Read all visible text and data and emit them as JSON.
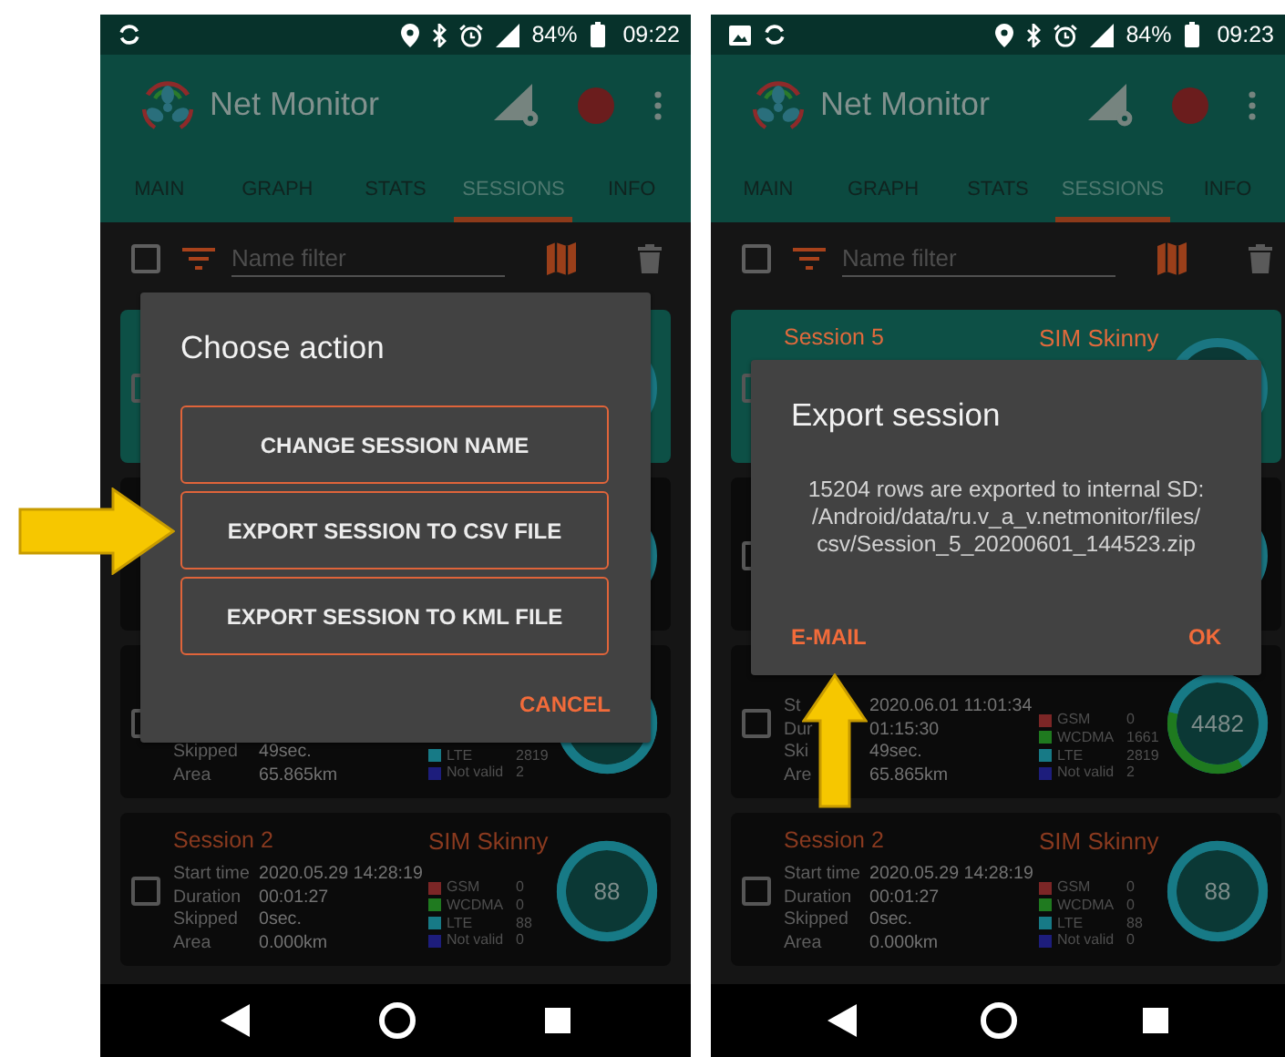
{
  "phones": [
    {
      "status_bar": {
        "notification_icons": [
          {
            "kind": "sync"
          }
        ],
        "battery": "84%",
        "time": "09:22"
      },
      "app_bar": {
        "title": "Net Monitor"
      },
      "tabs": [
        {
          "label": "MAIN",
          "selected": false
        },
        {
          "label": "GRAPH",
          "selected": false
        },
        {
          "label": "STATS",
          "selected": false
        },
        {
          "label": "SESSIONS",
          "selected": true
        },
        {
          "label": "INFO",
          "selected": false
        }
      ],
      "toolbar": {
        "select_all": {
          "checked": false
        },
        "placeholder": "Name filter"
      },
      "sessions": [
        {
          "selected": true,
          "checked": false
        },
        {
          "selected": false
        },
        {
          "selected": false,
          "checked": false,
          "stats": [
            {
              "label": "Skipped",
              "value": "49sec."
            },
            {
              "label": "Area",
              "value": "65.865km"
            }
          ],
          "legend": [
            {
              "name": "LTE",
              "value": "2819",
              "color": "#177a86"
            },
            {
              "name": "Not valid",
              "value": "2",
              "color": "#1d1d7c"
            }
          ]
        },
        {
          "selected": false,
          "checked": false,
          "name": "Session 2",
          "sim": "SIM Skinny",
          "stats": [
            {
              "label": "Start time",
              "value": "2020.05.29 14:28:19"
            },
            {
              "label": "Duration",
              "value": "00:01:27"
            },
            {
              "label": "Skipped",
              "value": "0sec."
            },
            {
              "label": "Area",
              "value": "0.000km"
            }
          ],
          "legend": [
            {
              "name": "GSM",
              "value": "0",
              "color": "#7c2626"
            },
            {
              "name": "WCDMA",
              "value": "0",
              "color": "#1f7a1f"
            },
            {
              "name": "LTE",
              "value": "88",
              "color": "#177a86"
            },
            {
              "name": "Not valid",
              "value": "0",
              "color": "#1d1d7c"
            }
          ],
          "count": "88"
        }
      ],
      "dialog": {
        "title": "Choose action",
        "options": [
          {
            "label": "CHANGE SESSION NAME",
            "highlighted": false
          },
          {
            "label": "EXPORT SESSION TO CSV FILE",
            "highlighted": true
          },
          {
            "label": "EXPORT SESSION TO KML FILE",
            "highlighted": false
          }
        ],
        "actions": [
          {
            "label": "CANCEL",
            "kind": "negative",
            "highlighted": false
          }
        ]
      }
    },
    {
      "status_bar": {
        "notification_icons": [
          {
            "kind": "image"
          },
          {
            "kind": "sync"
          }
        ],
        "battery": "84%",
        "time": "09:23"
      },
      "app_bar": {
        "title": "Net Monitor"
      },
      "tabs": [
        {
          "label": "MAIN",
          "selected": false
        },
        {
          "label": "GRAPH",
          "selected": false
        },
        {
          "label": "STATS",
          "selected": false
        },
        {
          "label": "SESSIONS",
          "selected": true
        },
        {
          "label": "INFO",
          "selected": false
        }
      ],
      "toolbar": {
        "select_all": {
          "checked": false
        },
        "placeholder": "Name filter"
      },
      "sessions": [
        {
          "selected": true,
          "checked": false,
          "name": "Session 5",
          "sim": "SIM Skinny"
        },
        {
          "selected": false,
          "checked": false
        },
        {
          "selected": false,
          "checked": false,
          "stats": [
            {
              "label": "St",
              "value": "2020.06.01 11:01:34"
            },
            {
              "label": "Dur",
              "value": "01:15:30"
            },
            {
              "label": "Ski",
              "value": "49sec."
            },
            {
              "label": "Are",
              "value": "65.865km"
            }
          ],
          "legend": [
            {
              "name": "GSM",
              "value": "0",
              "color": "#7c2626"
            },
            {
              "name": "WCDMA",
              "value": "1661",
              "color": "#1f7a1f"
            },
            {
              "name": "LTE",
              "value": "2819",
              "color": "#177a86"
            },
            {
              "name": "Not valid",
              "value": "2",
              "color": "#1d1d7c"
            }
          ],
          "count": "4482"
        },
        {
          "selected": false,
          "checked": false,
          "name": "Session 2",
          "sim": "SIM Skinny",
          "stats": [
            {
              "label": "Start time",
              "value": "2020.05.29 14:28:19"
            },
            {
              "label": "Duration",
              "value": "00:01:27"
            },
            {
              "label": "Skipped",
              "value": "0sec."
            },
            {
              "label": "Area",
              "value": "0.000km"
            }
          ],
          "legend": [
            {
              "name": "GSM",
              "value": "0",
              "color": "#7c2626"
            },
            {
              "name": "WCDMA",
              "value": "0",
              "color": "#1f7a1f"
            },
            {
              "name": "LTE",
              "value": "88",
              "color": "#177a86"
            },
            {
              "name": "Not valid",
              "value": "0",
              "color": "#1d1d7c"
            }
          ],
          "count": "88"
        }
      ],
      "dialog": {
        "title": "Export session",
        "message": "15204 rows are exported to internal SD:\n/Android/data/ru.v_a_v.netmonitor/files/\ncsv/Session_5_20200601_144523.zip",
        "actions": [
          {
            "label": "E-MAIL",
            "kind": "neutral",
            "highlighted": true
          },
          {
            "label": "OK",
            "kind": "positive",
            "highlighted": false
          }
        ]
      }
    }
  ]
}
